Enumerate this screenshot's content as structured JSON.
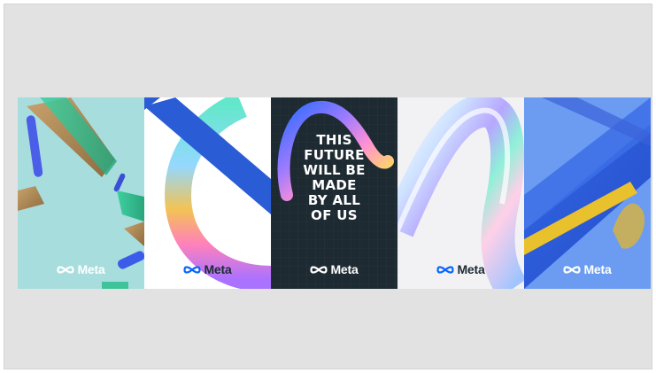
{
  "posters": [
    {
      "brand": "Meta",
      "background": "#a8ddde",
      "logo_color": "#ffffff",
      "icon": "meta-infinity-icon"
    },
    {
      "brand": "Meta",
      "background": "#ffffff",
      "logo_color": "#1c2b33",
      "icon": "meta-infinity-icon"
    },
    {
      "brand": "Meta",
      "background": "#1e2a32",
      "logo_color": "#ffffff",
      "icon": "meta-infinity-icon",
      "headline": [
        "THIS",
        "FUTURE",
        "WILL BE",
        "MADE",
        "BY ALL",
        "OF US"
      ]
    },
    {
      "brand": "Meta",
      "background": "#f2f2f4",
      "logo_color": "#1c2b33",
      "icon": "meta-infinity-icon"
    },
    {
      "brand": "Meta",
      "background": "#5a8ff0",
      "logo_color": "#ffffff",
      "icon": "meta-infinity-icon"
    }
  ]
}
